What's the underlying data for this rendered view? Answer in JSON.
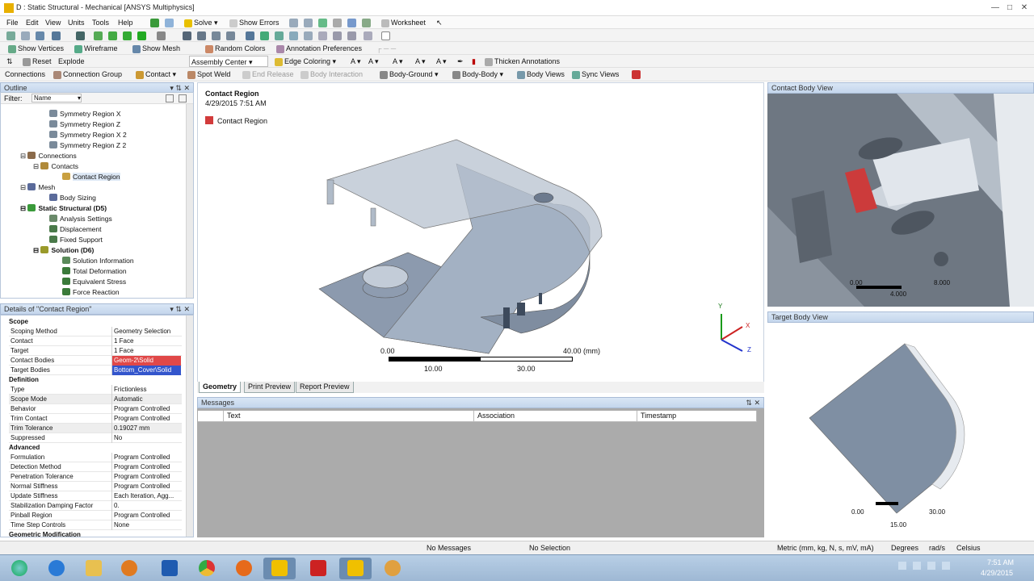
{
  "window": {
    "title": "D : Static Structural - Mechanical [ANSYS Multiphysics]"
  },
  "menu": [
    "File",
    "Edit",
    "View",
    "Units",
    "Tools",
    "Help"
  ],
  "toolbar1": {
    "solve": "Solve",
    "show_errors": "Show Errors",
    "worksheet": "Worksheet"
  },
  "toolbar3": {
    "show_vertices": "Show Vertices",
    "wireframe": "Wireframe",
    "show_mesh": "Show Mesh",
    "random_colors": "Random Colors",
    "annotation_prefs": "Annotation Preferences"
  },
  "toolbar4": {
    "reset": "Reset",
    "explode": "Explode",
    "assembly_center": "Assembly Center",
    "edge_coloring": "Edge Coloring",
    "thicken": "Thicken Annotations"
  },
  "toolbar5": {
    "connections": "Connections",
    "connection_group": "Connection Group",
    "contact": "Contact",
    "spot_weld": "Spot Weld",
    "end_release": "End Release",
    "body_interaction": "Body Interaction",
    "body_ground": "Body-Ground",
    "body_body": "Body-Body",
    "body_views": "Body Views",
    "sync_views": "Sync Views"
  },
  "outline": {
    "header": "Outline",
    "filter_label": "Filter:",
    "filter_value": "Name",
    "items": [
      {
        "label": "Symmetry Region X"
      },
      {
        "label": "Symmetry Region Z"
      },
      {
        "label": "Symmetry Region X 2"
      },
      {
        "label": "Symmetry Region Z 2"
      },
      {
        "label": "Connections"
      },
      {
        "label": "Contacts"
      },
      {
        "label": "Contact Region"
      },
      {
        "label": "Mesh"
      },
      {
        "label": "Body Sizing"
      },
      {
        "label": "Static Structural (D5)"
      },
      {
        "label": "Analysis Settings"
      },
      {
        "label": "Displacement"
      },
      {
        "label": "Fixed Support"
      },
      {
        "label": "Solution (D6)"
      },
      {
        "label": "Solution Information"
      },
      {
        "label": "Total Deformation"
      },
      {
        "label": "Equivalent Stress"
      },
      {
        "label": "Force Reaction"
      }
    ]
  },
  "details": {
    "header": "Details of \"Contact Region\"",
    "sections": {
      "scope": "Scope",
      "definition": "Definition",
      "advanced": "Advanced",
      "geom_mod": "Geometric Modification"
    },
    "rows": [
      {
        "k": "Scoping Method",
        "v": "Geometry Selection"
      },
      {
        "k": "Contact",
        "v": "1 Face"
      },
      {
        "k": "Target",
        "v": "1 Face"
      },
      {
        "k": "Contact Bodies",
        "v": "Geom-2\\Solid"
      },
      {
        "k": "Target Bodies",
        "v": "Bottom_Cover\\Solid"
      },
      {
        "k": "Type",
        "v": "Frictionless"
      },
      {
        "k": "Scope Mode",
        "v": "Automatic"
      },
      {
        "k": "Behavior",
        "v": "Program Controlled"
      },
      {
        "k": "Trim Contact",
        "v": "Program Controlled"
      },
      {
        "k": "Trim Tolerance",
        "v": "0.19027 mm"
      },
      {
        "k": "Suppressed",
        "v": "No"
      },
      {
        "k": "Formulation",
        "v": "Program Controlled"
      },
      {
        "k": "Detection Method",
        "v": "Program Controlled"
      },
      {
        "k": "Penetration Tolerance",
        "v": "Program Controlled"
      },
      {
        "k": "Normal Stiffness",
        "v": "Program Controlled"
      },
      {
        "k": "Update Stiffness",
        "v": "Each Iteration, Agg..."
      },
      {
        "k": "Stabilization Damping Factor",
        "v": "0."
      },
      {
        "k": "Pinball Region",
        "v": "Program Controlled"
      },
      {
        "k": "Time Step Controls",
        "v": "None"
      }
    ]
  },
  "viewport": {
    "title": "Contact Region",
    "timestamp": "4/29/2015 7:51 AM",
    "legend": "Contact Region",
    "scale": {
      "l0": "0.00",
      "l1": "40.00 (mm)",
      "l2": "10.00",
      "l3": "30.00"
    },
    "axes": {
      "x": "X",
      "y": "Y",
      "z": "Z"
    }
  },
  "tabs": [
    "Geometry",
    "Print Preview",
    "Report Preview"
  ],
  "messages": {
    "header": "Messages",
    "cols": [
      "Text",
      "Association",
      "Timestamp"
    ]
  },
  "contact_view": {
    "header": "Contact Body View",
    "s0": "0.00",
    "s1": "8.000",
    "s2": "4.000"
  },
  "target_view": {
    "header": "Target Body View",
    "s0": "0.00",
    "s1": "30.00",
    "s2": "15.00"
  },
  "status": {
    "messages": "No Messages",
    "selection": "No Selection",
    "units": "Metric (mm, kg, N, s, mV, mA)",
    "deg": "Degrees",
    "rad": "rad/s",
    "temp": "Celsius"
  },
  "clock": {
    "time": "7:51 AM",
    "date": "4/29/2015"
  },
  "colors": {
    "accent_red": "#d23b3b",
    "panel_header": "#c4d6ec"
  }
}
